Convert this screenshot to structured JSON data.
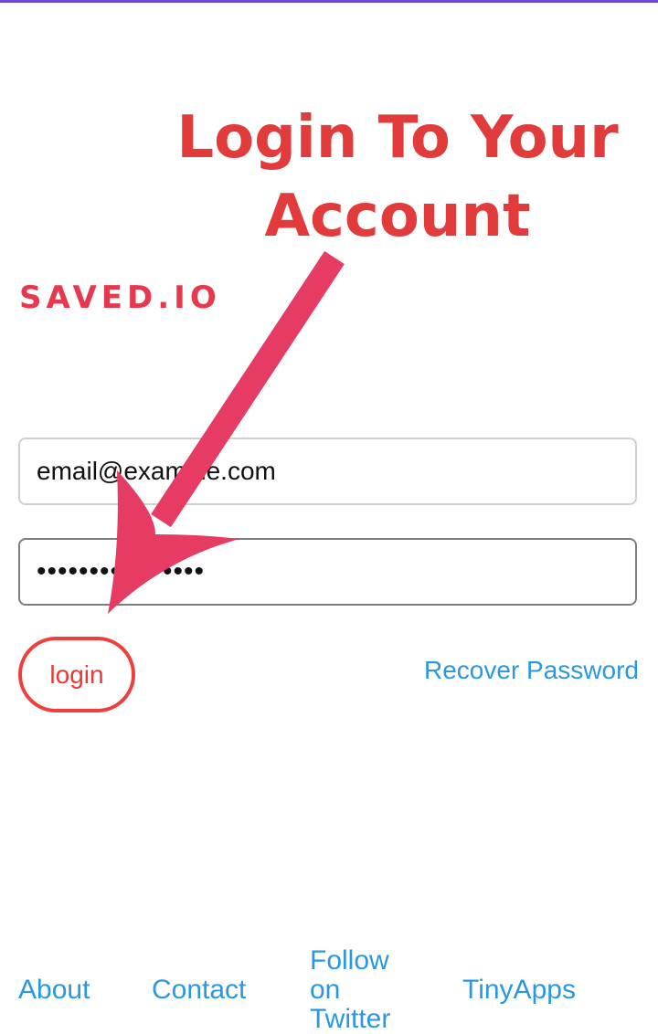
{
  "annotation": {
    "title_line1": "Login To Your",
    "title_line2": "Account",
    "arrow_color": "#e63b62"
  },
  "brand": {
    "name": "SAVED.IO",
    "color": "#e63950"
  },
  "form": {
    "email_value": "email@example.com",
    "password_value": "••••••••••••••••"
  },
  "actions": {
    "login_label": "login",
    "recover_label": "Recover Password"
  },
  "footer": {
    "about": "About",
    "contact": "Contact",
    "follow": "Follow on Twitter",
    "tinyapps": "TinyApps"
  },
  "colors": {
    "accent_red": "#e23b3b",
    "link_blue": "#2b97e0",
    "top_bar": "#6a4bd6"
  }
}
